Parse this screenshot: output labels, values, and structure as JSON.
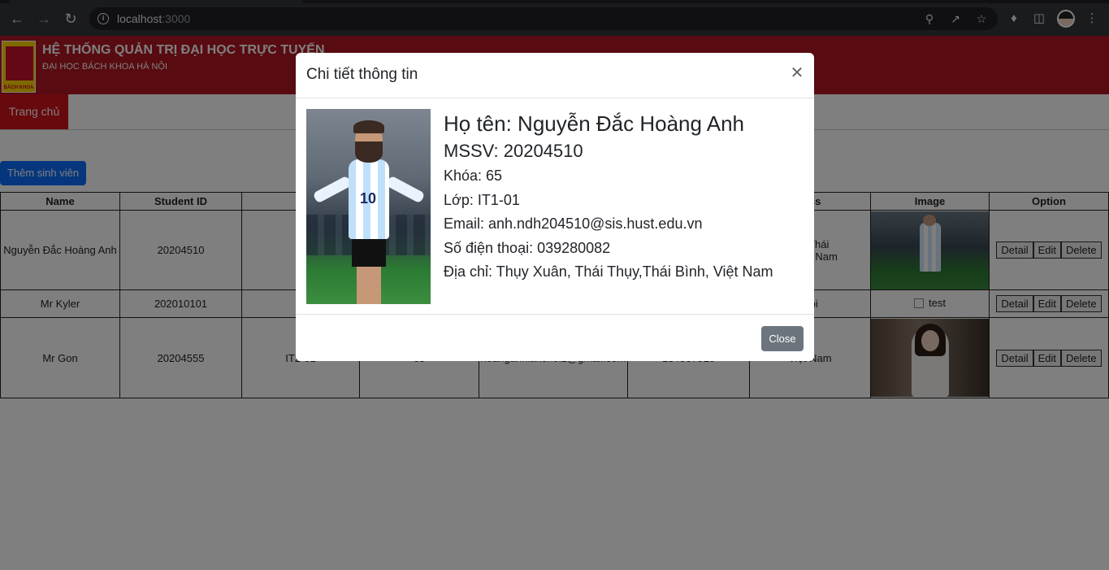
{
  "browser": {
    "url_host": "localhost",
    "url_port": ":3000"
  },
  "header": {
    "title": "HỆ THỐNG QUẢN TRỊ ĐẠI HỌC TRỰC TUYẾN",
    "subtitle": "ĐẠI HỌC BÁCH KHOA HÀ NỘI",
    "logo_text": "BÁCH KHOA"
  },
  "nav": {
    "home": "Trang chủ"
  },
  "actions": {
    "add_student": "Thêm sinh viên"
  },
  "table": {
    "headers": [
      "Name",
      "Student ID",
      "C",
      "",
      "",
      "",
      "ress",
      "Image",
      "Option"
    ],
    "rows": [
      {
        "name": "Nguyễn Đắc Hoàng Anh",
        "student_id": "20204510",
        "class": "IT",
        "course": "",
        "email": "",
        "phone": "",
        "address": "ân, Thái\nh, Việt Nam",
        "image_alt": ""
      },
      {
        "name": "Mr Kyler",
        "student_id": "202010101",
        "class": "IT",
        "course": "",
        "email": "",
        "phone": "",
        "address": "Nội",
        "image_alt": "test"
      },
      {
        "name": "Mr Gon",
        "student_id": "20204555",
        "class": "IT2-01",
        "course": "65",
        "email": "hoanganhlakenoi2@gmail.com",
        "phone": "134567910",
        "address": "Việt Nam",
        "image_alt": ""
      }
    ],
    "option_labels": {
      "detail": "Detail",
      "edit": "Edit",
      "delete": "Delete"
    }
  },
  "modal": {
    "title": "Chi tiết thông tin",
    "name_line": "Họ tên: Nguyễn Đắc Hoàng Anh",
    "mssv_line": "MSSV: 20204510",
    "khoa_line": "Khóa: 65",
    "lop_line": "Lớp: IT1-01",
    "email_line": "Email: anh.ndh204510@sis.hust.edu.vn",
    "phone_line": "Số điện thoại: 039280082",
    "address_line": "Địa chỉ: Thụy Xuân, Thái Thụy,Thái Bình, Việt Nam",
    "close_label": "Close"
  }
}
